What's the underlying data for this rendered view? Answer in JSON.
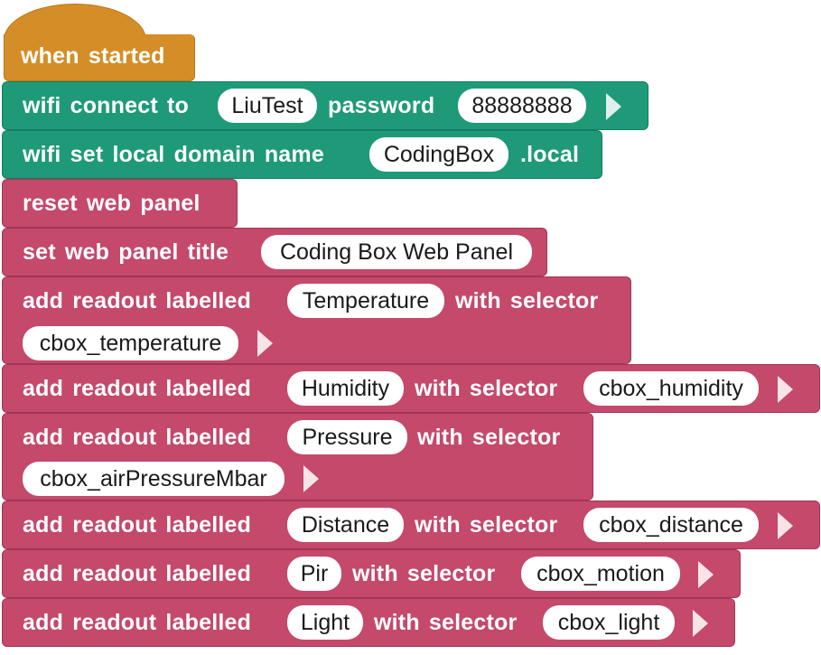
{
  "hat": {
    "label": "when started"
  },
  "wifi_connect": {
    "label": "wifi connect to",
    "ssid": "LiuTest",
    "password_label": "password",
    "password": "88888888"
  },
  "wifi_domain": {
    "label": "wifi set local domain name",
    "domain": "CodingBox",
    "suffix": ".local"
  },
  "reset_panel": {
    "label": "reset web panel"
  },
  "set_title": {
    "label": "set web panel title",
    "title": "Coding Box Web Panel"
  },
  "readouts": [
    {
      "prefix": "add readout labelled",
      "label": "Temperature",
      "with": "with selector",
      "selector": "cbox_temperature"
    },
    {
      "prefix": "add readout labelled",
      "label": "Humidity",
      "with": "with selector",
      "selector": "cbox_humidity"
    },
    {
      "prefix": "add readout labelled",
      "label": "Pressure",
      "with": "with selector",
      "selector": "cbox_airPressureMbar"
    },
    {
      "prefix": "add readout labelled",
      "label": "Distance",
      "with": "with selector",
      "selector": "cbox_distance"
    },
    {
      "prefix": "add readout labelled",
      "label": "Pir",
      "with": "with selector",
      "selector": "cbox_motion"
    },
    {
      "prefix": "add readout labelled",
      "label": "Light",
      "with": "with selector",
      "selector": "cbox_light"
    }
  ],
  "colors": {
    "event": "#d58e27",
    "wifi": "#1e9a79",
    "panel": "#c4496a"
  },
  "icons": {
    "expand": "triangle-right-icon"
  }
}
